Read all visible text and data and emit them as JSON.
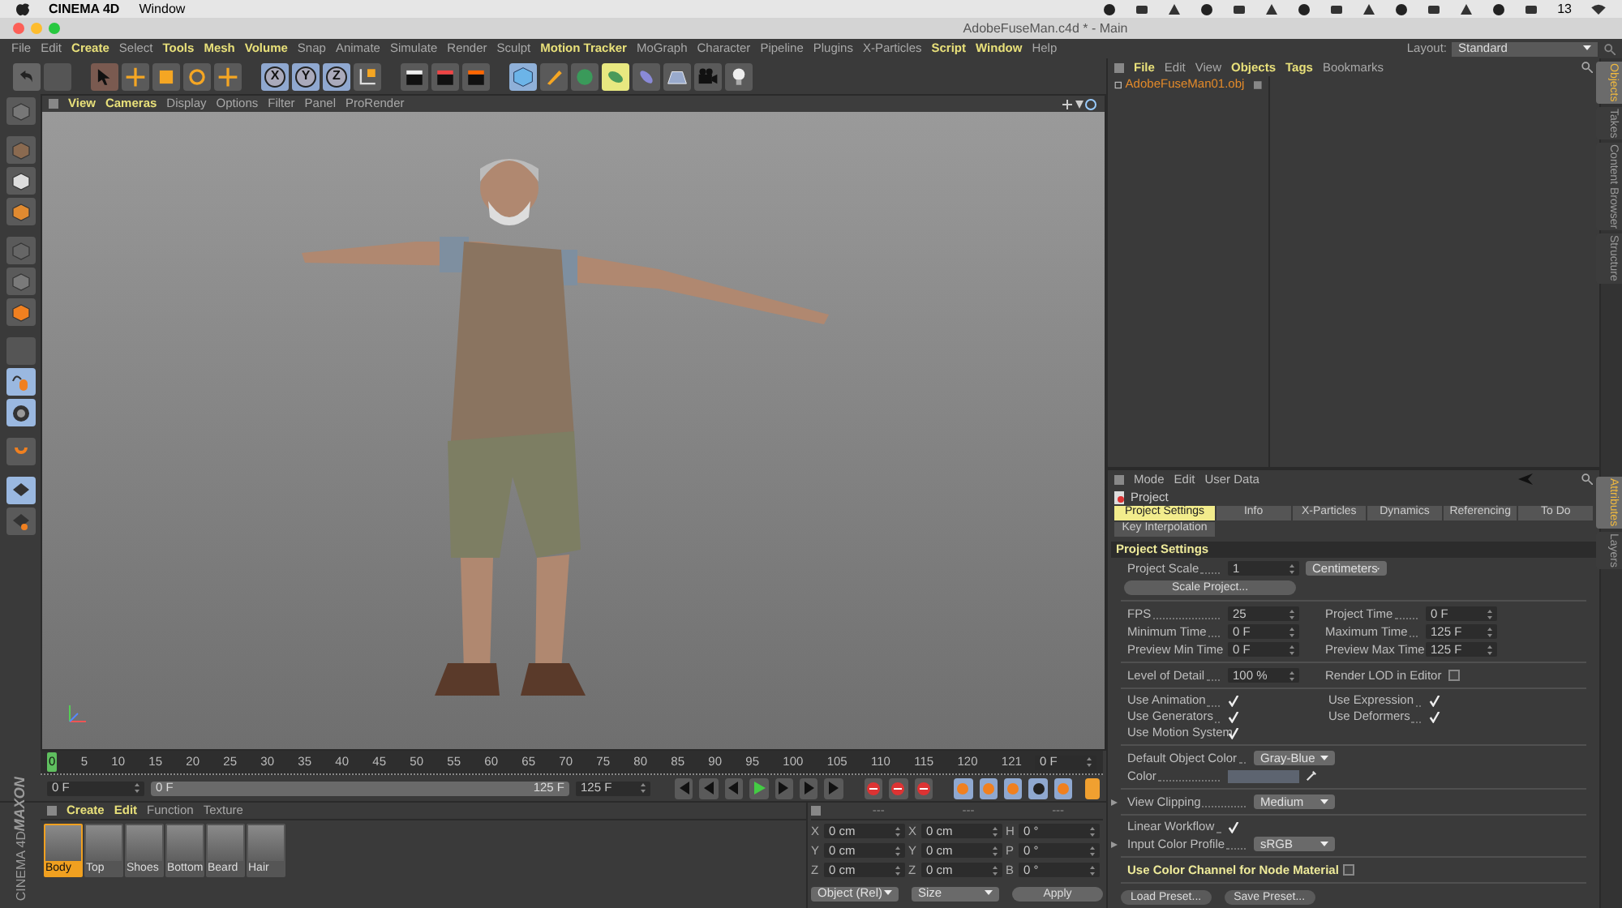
{
  "mac_menubar": {
    "app": "CINEMA 4D",
    "menus": [
      "Window"
    ],
    "badge": "13"
  },
  "window": {
    "title": "AdobeFuseMan.c4d * - Main"
  },
  "menu": [
    {
      "label": "File",
      "highlighted": false
    },
    {
      "label": "Edit",
      "highlighted": false
    },
    {
      "label": "Create",
      "highlighted": true
    },
    {
      "label": "Select",
      "highlighted": false
    },
    {
      "label": "Tools",
      "highlighted": true
    },
    {
      "label": "Mesh",
      "highlighted": true
    },
    {
      "label": "Volume",
      "highlighted": true
    },
    {
      "label": "Snap",
      "highlighted": false
    },
    {
      "label": "Animate",
      "highlighted": false
    },
    {
      "label": "Simulate",
      "highlighted": false
    },
    {
      "label": "Render",
      "highlighted": false
    },
    {
      "label": "Sculpt",
      "highlighted": false
    },
    {
      "label": "Motion Tracker",
      "highlighted": true
    },
    {
      "label": "MoGraph",
      "highlighted": false
    },
    {
      "label": "Character",
      "highlighted": false
    },
    {
      "label": "Pipeline",
      "highlighted": false
    },
    {
      "label": "Plugins",
      "highlighted": false
    },
    {
      "label": "X-Particles",
      "highlighted": false
    },
    {
      "label": "Script",
      "highlighted": true
    },
    {
      "label": "Window",
      "highlighted": true
    },
    {
      "label": "Help",
      "highlighted": false
    }
  ],
  "layout": {
    "label": "Layout:",
    "value": "Standard"
  },
  "toolbar": {
    "axes": [
      {
        "label": "X",
        "selected": true
      },
      {
        "label": "Y",
        "selected": true
      },
      {
        "label": "Z",
        "selected": true
      }
    ]
  },
  "viewport": {
    "menu": [
      {
        "label": "View",
        "highlighted": true
      },
      {
        "label": "Cameras",
        "highlighted": true
      },
      {
        "label": "Display",
        "highlighted": false
      },
      {
        "label": "Options",
        "highlighted": false
      },
      {
        "label": "Filter",
        "highlighted": false
      },
      {
        "label": "Panel",
        "highlighted": false
      },
      {
        "label": "ProRender",
        "highlighted": false
      }
    ]
  },
  "timeline": {
    "ticks": [
      "0",
      "5",
      "10",
      "15",
      "20",
      "25",
      "30",
      "35",
      "40",
      "45",
      "50",
      "55",
      "60",
      "65",
      "70",
      "75",
      "80",
      "85",
      "90",
      "95",
      "100",
      "105",
      "110",
      "115",
      "120",
      "121"
    ],
    "frame_field": "0 F",
    "start_field": "0 F",
    "range_start": "0 F",
    "range_end": "125 F",
    "end_field": "125 F"
  },
  "material_manager": {
    "menu": [
      {
        "label": "Create",
        "highlighted": true
      },
      {
        "label": "Edit",
        "highlighted": true
      },
      {
        "label": "Function",
        "highlighted": false
      },
      {
        "label": "Texture",
        "highlighted": false
      }
    ],
    "materials": [
      {
        "name": "Body",
        "selected": true
      },
      {
        "name": "Top",
        "selected": false
      },
      {
        "name": "Shoes",
        "selected": false
      },
      {
        "name": "Bottom",
        "selected": false
      },
      {
        "name": "Beard",
        "selected": false
      },
      {
        "name": "Hair",
        "selected": false
      }
    ]
  },
  "logo": {
    "brand": "MAXON",
    "product": "CINEMA 4D"
  },
  "coordinates": {
    "headers": [
      "---",
      "---",
      "---"
    ],
    "rows": [
      [
        "X",
        "0 cm",
        "X",
        "0 cm",
        "H",
        "0 °"
      ],
      [
        "Y",
        "0 cm",
        "Y",
        "0 cm",
        "P",
        "0 °"
      ],
      [
        "Z",
        "0 cm",
        "Z",
        "0 cm",
        "B",
        "0 °"
      ]
    ],
    "dropdowns": [
      "Object (Rel)",
      "Size"
    ],
    "apply": "Apply"
  },
  "object_manager": {
    "menu": [
      {
        "label": "File",
        "highlighted": true
      },
      {
        "label": "Edit",
        "highlighted": false
      },
      {
        "label": "View",
        "highlighted": false
      },
      {
        "label": "Objects",
        "highlighted": true
      },
      {
        "label": "Tags",
        "highlighted": true
      },
      {
        "label": "Bookmarks",
        "highlighted": false
      }
    ],
    "objects": [
      {
        "name": "AdobeFuseMan01.obj"
      }
    ]
  },
  "side_tabs_top": [
    {
      "label": "Objects",
      "selected": true
    },
    {
      "label": "Takes",
      "selected": false
    },
    {
      "label": "Content Browser",
      "selected": false
    },
    {
      "label": "Structure",
      "selected": false
    }
  ],
  "side_tabs_bottom": [
    {
      "label": "Attributes",
      "selected": true
    },
    {
      "label": "Layers",
      "selected": false
    }
  ],
  "attributes": {
    "menu": [
      "Mode",
      "Edit",
      "User Data"
    ],
    "object": "Project",
    "tabs": [
      {
        "label": "Project Settings",
        "selected": true
      },
      {
        "label": "Info",
        "selected": false
      },
      {
        "label": "X-Particles",
        "selected": false
      },
      {
        "label": "Dynamics",
        "selected": false
      },
      {
        "label": "Referencing",
        "selected": false
      },
      {
        "label": "To Do",
        "selected": false
      },
      {
        "label": "Key Interpolation",
        "selected": false
      }
    ],
    "section": "Project Settings",
    "rows": [
      {
        "kind": "scale",
        "label": "Project Scale",
        "value": "1",
        "unit": "Centimeters"
      },
      {
        "kind": "button",
        "label": "Scale Project..."
      },
      {
        "kind": "separator"
      },
      {
        "kind": "pair",
        "left": {
          "label": "FPS",
          "value": "25"
        },
        "right": {
          "label": "Project Time",
          "value": "0 F"
        }
      },
      {
        "kind": "pair",
        "left": {
          "label": "Minimum Time",
          "value": "0 F"
        },
        "right": {
          "label": "Maximum Time",
          "value": "125 F"
        }
      },
      {
        "kind": "pair",
        "left": {
          "label": "Preview Min Time",
          "value": "0 F"
        },
        "right": {
          "label": "Preview Max Time",
          "value": "125 F"
        }
      },
      {
        "kind": "separator"
      },
      {
        "kind": "lod",
        "label": "Level of Detail",
        "value": "100 %",
        "check_label": "Render LOD in Editor",
        "checked": false
      },
      {
        "kind": "separator"
      },
      {
        "kind": "checks",
        "left": {
          "label": "Use Animation",
          "checked": true
        },
        "right": {
          "label": "Use Expression",
          "checked": true
        }
      },
      {
        "kind": "checks",
        "left": {
          "label": "Use Generators",
          "checked": true
        },
        "right": {
          "label": "Use Deformers",
          "checked": true
        }
      },
      {
        "kind": "check",
        "label": "Use Motion System",
        "checked": true,
        "highlighted": false
      },
      {
        "kind": "separator"
      },
      {
        "kind": "dropdown",
        "label": "Default Object Color",
        "value": "Gray-Blue",
        "expandable": false
      },
      {
        "kind": "color",
        "label": "Color"
      },
      {
        "kind": "separator"
      },
      {
        "kind": "dropdown",
        "label": "View Clipping",
        "value": "Medium",
        "expandable": true
      },
      {
        "kind": "separator"
      },
      {
        "kind": "check",
        "label": "Linear Workflow",
        "checked": true,
        "highlighted": false
      },
      {
        "kind": "dropdown",
        "label": "Input Color Profile",
        "value": "sRGB",
        "expandable": true
      },
      {
        "kind": "separator"
      },
      {
        "kind": "check",
        "label": "Use Color Channel for Node Material",
        "checked": false,
        "highlighted": true
      },
      {
        "kind": "separator"
      },
      {
        "kind": "presets",
        "buttons": [
          "Load Preset...",
          "Save Preset..."
        ]
      }
    ]
  }
}
